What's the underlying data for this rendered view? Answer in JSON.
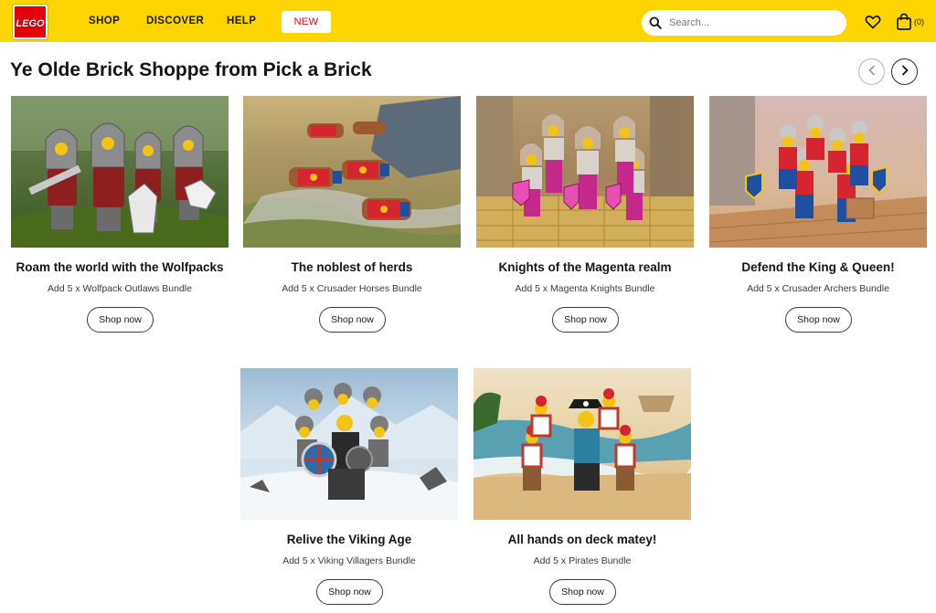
{
  "header": {
    "logo_text": "LEGO",
    "nav": {
      "shop": "SHOP",
      "discover": "DISCOVER",
      "help": "HELP",
      "new": "NEW"
    },
    "search_placeholder": "Search...",
    "bag_count": "(0)",
    "icons": [
      "search-icon",
      "heart-icon",
      "shopping-bag-icon"
    ]
  },
  "page_title": "Ye Olde Brick Shoppe from Pick a Brick",
  "carousel": {
    "prev_icon": "chevron-left-icon",
    "next_icon": "chevron-right-icon"
  },
  "colors": {
    "brand_yellow": "#ffd500",
    "brand_red": "#e3000b",
    "new_text": "#e3000b"
  },
  "cards": [
    {
      "title": "Roam the world with the Wolfpacks",
      "subtitle": "Add 5 x Wolfpack Outlaws Bundle",
      "button": "Shop now"
    },
    {
      "title": "The noblest of herds",
      "subtitle": "Add 5 x Crusader Horses Bundle",
      "button": "Shop now"
    },
    {
      "title": "Knights of the Magenta realm",
      "subtitle": "Add 5 x Magenta Knights Bundle",
      "button": "Shop now"
    },
    {
      "title": "Defend the King & Queen!",
      "subtitle": "Add 5 x Crusader Archers Bundle",
      "button": "Shop now"
    },
    {
      "title": "Relive the Viking Age",
      "subtitle": "Add 5 x Viking Villagers Bundle",
      "button": "Shop now"
    },
    {
      "title": "All hands on deck matey!",
      "subtitle": "Add 5 x Pirates Bundle",
      "button": "Shop now"
    }
  ]
}
